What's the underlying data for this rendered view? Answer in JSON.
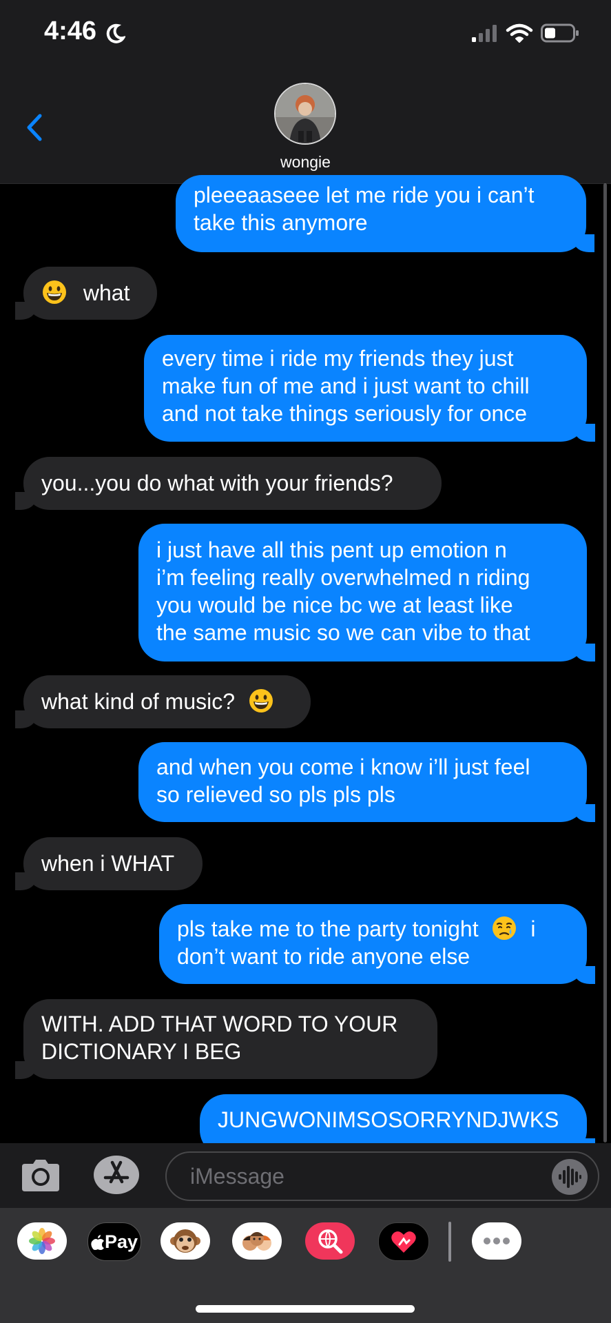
{
  "status_bar": {
    "time": "4:46",
    "icons": [
      "moon-icon",
      "signal-icon",
      "wifi-icon",
      "battery-icon"
    ]
  },
  "header": {
    "contact_name": "wongie",
    "icons": [
      "back-chevron-icon",
      "avatar"
    ]
  },
  "colors": {
    "sent_bubble": "#0a84ff",
    "received_bubble": "#262628",
    "background": "#000000",
    "header": "#1c1c1e"
  },
  "messages": [
    {
      "from": "me",
      "lines": [
        "pleeeaaseee let me ride you i can’t",
        "take this anymore"
      ]
    },
    {
      "from": "them",
      "lines": [
        "what"
      ],
      "emoji": "grinning-face-emoji"
    },
    {
      "from": "me",
      "lines": [
        "every time i ride my friends they just",
        "make fun of me and i just want to chill",
        "and not take things seriously for once"
      ]
    },
    {
      "from": "them",
      "lines": [
        "you...you do what with your friends?"
      ]
    },
    {
      "from": "me",
      "lines": [
        "i just have all this pent up emotion n",
        "i’m feeling really overwhelmed n riding",
        "you would be nice bc we at least like",
        "the same music so we can vibe to that"
      ]
    },
    {
      "from": "them",
      "lines": [
        "what kind of music?"
      ],
      "emoji": "grinning-face-emoji"
    },
    {
      "from": "me",
      "lines": [
        "and when you come i know i’ll just feel",
        "so relieved so pls pls pls"
      ]
    },
    {
      "from": "them",
      "lines": [
        "when i WHAT"
      ]
    },
    {
      "from": "me",
      "lines": [
        "pls take me to the party tonight",
        "don’t want to ride anyone else"
      ],
      "line0_suffix": "i",
      "emoji": "face-holding-back-tears-emoji"
    },
    {
      "from": "them",
      "lines": [
        "WITH. ADD THAT WORD TO YOUR",
        "DICTIONARY I BEG"
      ]
    },
    {
      "from": "me",
      "lines": [
        "JUNGWONIMSOSORRYNDJWKS"
      ]
    }
  ],
  "input_bar": {
    "placeholder": "iMessage",
    "value": "",
    "icons": [
      "camera-icon",
      "app-store-icon",
      "voice-waveform-icon"
    ]
  },
  "app_strip": {
    "apps": [
      "photos-icon",
      "apple-pay-icon",
      "monkey-memoji-icon",
      "memoji-stickers-icon",
      "search-images-icon",
      "digital-touch-icon",
      "more-apps-icon"
    ],
    "pay_label": "Pay"
  }
}
